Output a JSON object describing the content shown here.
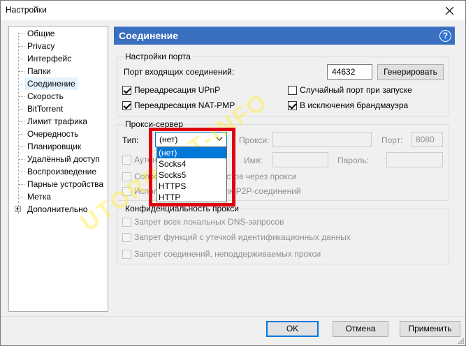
{
  "window": {
    "title": "Настройки"
  },
  "sidebar": {
    "items": [
      {
        "label": "Общие"
      },
      {
        "label": "Privacy"
      },
      {
        "label": "Интерфейс"
      },
      {
        "label": "Папки"
      },
      {
        "label": "Соединение"
      },
      {
        "label": "Скорость"
      },
      {
        "label": "BitTorrent"
      },
      {
        "label": "Лимит трафика"
      },
      {
        "label": "Очередность"
      },
      {
        "label": "Планировщик"
      },
      {
        "label": "Удалённый доступ"
      },
      {
        "label": "Воспроизведение"
      },
      {
        "label": "Парные устройства"
      },
      {
        "label": "Метка"
      },
      {
        "label": "Дополнительно"
      }
    ],
    "selected": "Соединение"
  },
  "header": {
    "title": "Соединение",
    "help_icon": "?"
  },
  "port_settings": {
    "group_label": "Настройки порта",
    "incoming_port_label": "Порт входящих соединений:",
    "incoming_port_value": "44632",
    "generate_label": "Генерировать",
    "upnp_label": "Переадресация UPnP",
    "natpmp_label": "Переадресация NAT-PMP",
    "random_port_label": "Случайный порт при запуске",
    "firewall_label": "В исключения брандмауэра"
  },
  "proxy": {
    "group_label": "Прокси-сервер",
    "type_label": "Тип:",
    "type_value": "(нет)",
    "proxy_label": "Прокси:",
    "port_label": "Порт:",
    "port_value": "8080",
    "auth_label": "Аутентификация",
    "login_label": "Имя:",
    "password_label": "Пароль:",
    "hostname_label": "Сопоставлять имена хостов через прокси",
    "p2p_label": "Использовать прокси для P2P-соединений",
    "options": [
      "(нет)",
      "Socks4",
      "Socks5",
      "HTTPS",
      "HTTP"
    ]
  },
  "privacy": {
    "group_label": "Конфиденциальность прокси",
    "dns_label": "Запрет всех локальных DNS-запросов",
    "leak_label": "Запрет функций с утечкой идентификационных данных",
    "unsupported_label": "Запрет соединений, неподдерживаемых прокси"
  },
  "footer": {
    "ok_label": "OK",
    "cancel_label": "Отмена",
    "apply_label": "Применить"
  },
  "watermark": {
    "text": "UTORRENT-INFO"
  },
  "colors": {
    "header": "#3a6ebf",
    "highlight": "#e00010",
    "accent": "#0078d7"
  }
}
